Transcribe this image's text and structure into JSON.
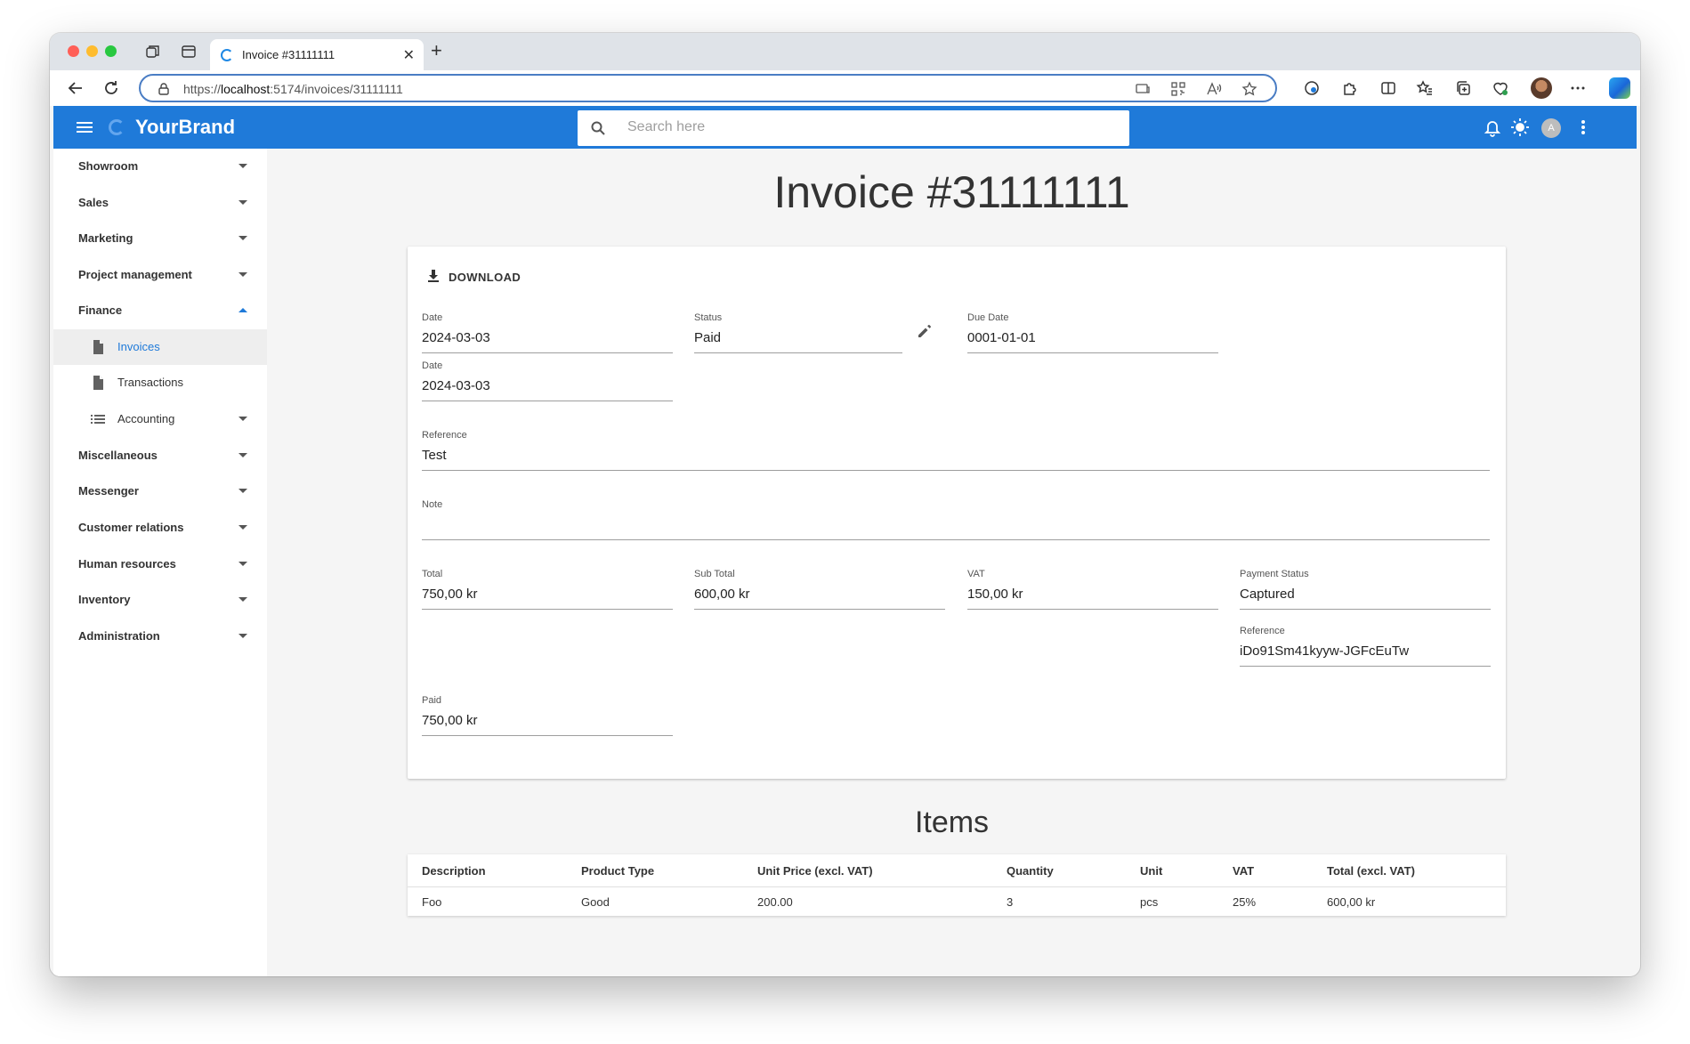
{
  "browser": {
    "tab_title": "Invoice #31111111",
    "url_prefix": "https://",
    "url_host": "localhost",
    "url_path": ":5174/invoices/31111111"
  },
  "appbar": {
    "brand": "YourBrand",
    "search_placeholder": "Search here",
    "avatar_initial": "A"
  },
  "sidebar": {
    "items": [
      {
        "label": "Showroom"
      },
      {
        "label": "Sales"
      },
      {
        "label": "Marketing"
      },
      {
        "label": "Project management"
      },
      {
        "label": "Finance"
      },
      {
        "label": "Miscellaneous"
      },
      {
        "label": "Messenger"
      },
      {
        "label": "Customer relations"
      },
      {
        "label": "Human resources"
      },
      {
        "label": "Inventory"
      },
      {
        "label": "Administration"
      }
    ],
    "finance_children": [
      {
        "label": "Invoices"
      },
      {
        "label": "Transactions"
      },
      {
        "label": "Accounting"
      }
    ]
  },
  "page": {
    "title": "Invoice #31111111",
    "download_label": "DOWNLOAD",
    "fields": {
      "date": {
        "label": "Date",
        "value": "2024-03-03"
      },
      "status": {
        "label": "Status",
        "value": "Paid"
      },
      "due_date": {
        "label": "Due Date",
        "value": "0001-01-01"
      },
      "date2": {
        "label": "Date",
        "value": "2024-03-03"
      },
      "reference": {
        "label": "Reference",
        "value": "Test"
      },
      "note": {
        "label": "Note",
        "value": ""
      },
      "total": {
        "label": "Total",
        "value": "750,00 kr"
      },
      "sub_total": {
        "label": "Sub Total",
        "value": "600,00 kr"
      },
      "vat": {
        "label": "VAT",
        "value": "150,00 kr"
      },
      "payment_status": {
        "label": "Payment Status",
        "value": "Captured"
      },
      "payment_reference": {
        "label": "Reference",
        "value": "iDo91Sm41kyyw-JGFcEuTw"
      },
      "paid": {
        "label": "Paid",
        "value": "750,00 kr"
      }
    },
    "items_title": "Items",
    "items_table": {
      "headers": [
        "Description",
        "Product Type",
        "Unit Price (excl. VAT)",
        "Quantity",
        "Unit",
        "VAT",
        "Total (excl. VAT)"
      ],
      "rows": [
        [
          "Foo",
          "Good",
          "200.00",
          "3",
          "pcs",
          "25%",
          "600,00 kr"
        ]
      ]
    }
  },
  "colors": {
    "appbar": "#1f7ad9",
    "active_nav": "#1f7ad9"
  }
}
